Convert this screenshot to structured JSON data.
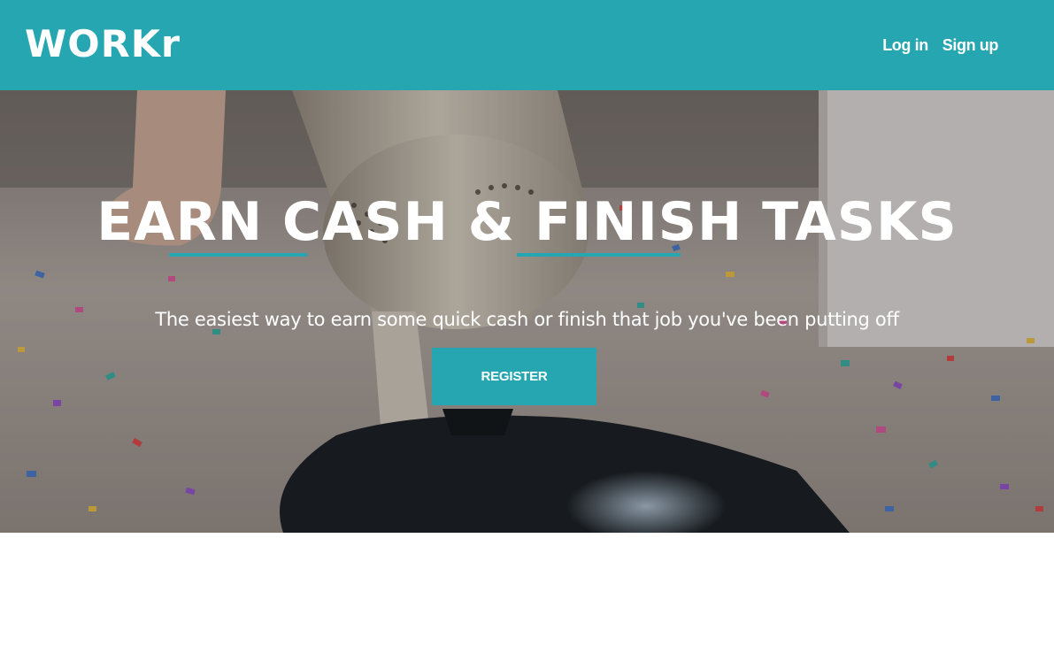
{
  "header": {
    "logo_text": "WORKr",
    "nav": {
      "login_label": "Log in",
      "signup_label": "Sign up"
    }
  },
  "hero": {
    "title": "EARN CASH & FINISH TASKS",
    "subtitle": "The easiest way to earn some quick cash or finish that job you've been putting off",
    "register_label": "REGISTER"
  },
  "colors": {
    "accent": "#25a6b0",
    "text_on_accent": "#ffffff",
    "page_background": "#ffffff"
  }
}
